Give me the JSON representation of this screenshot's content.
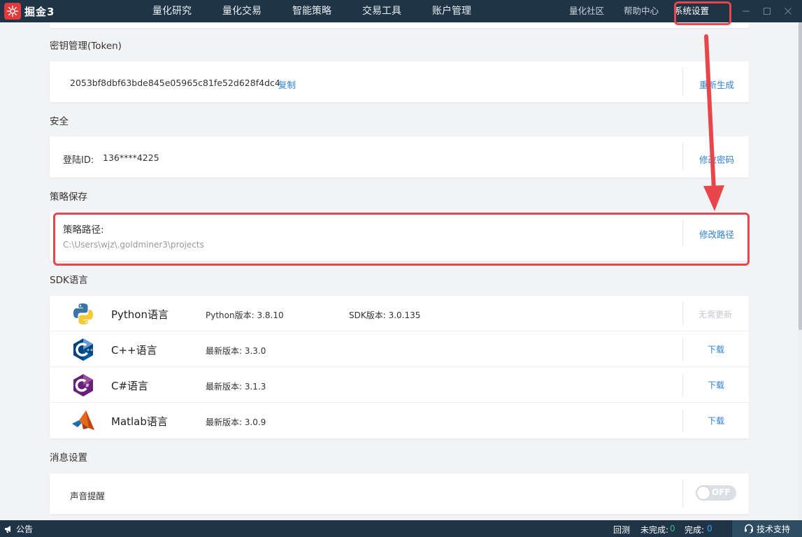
{
  "app": {
    "name": "掘金3",
    "brand_color": "#e03a3a"
  },
  "nav": [
    "量化研究",
    "量化交易",
    "智能策略",
    "交易工具",
    "账户管理"
  ],
  "top_right": {
    "community": "量化社区",
    "help": "帮助中心",
    "settings": "系统设置"
  },
  "token": {
    "title": "密钥管理(Token)",
    "value": "2053bf8dbf63bde845e05965c81fe52d628f4dc4",
    "copy": "复制",
    "regen": "重新生成"
  },
  "security": {
    "title": "安全",
    "login_label": "登陆ID:",
    "login_value": "136****4225",
    "change_pwd": "修改密码"
  },
  "strategy": {
    "title": "策略保存",
    "path_label": "策略路径:",
    "path_value": "C:\\Users\\wjz\\.goldminer3\\projects",
    "change_path": "修改路径"
  },
  "sdk": {
    "title": "SDK语言",
    "rows": [
      {
        "name": "Python语言",
        "version": "Python版本: 3.8.10",
        "sdk_version": "SDK版本: 3.0.135",
        "action": "无需更新"
      },
      {
        "name": "C++语言",
        "version": "最新版本: 3.3.0",
        "action": "下载"
      },
      {
        "name": "C#语言",
        "version": "最新版本: 3.1.3",
        "action": "下载"
      },
      {
        "name": "Matlab语言",
        "version": "最新版本: 3.0.9",
        "action": "下载"
      }
    ]
  },
  "message": {
    "title": "消息设置",
    "sound_label": "声音提醒",
    "toggle_state": "OFF"
  },
  "statusbar": {
    "notice": "公告",
    "backtest": "回测",
    "incomplete_label": "未完成:",
    "incomplete_value": "0",
    "complete_label": "完成:",
    "complete_value": "0",
    "support": "技术支持"
  },
  "colors": {
    "topbar": "#1f3547",
    "link": "#2f7fd3",
    "annotation": "#e8464b"
  }
}
